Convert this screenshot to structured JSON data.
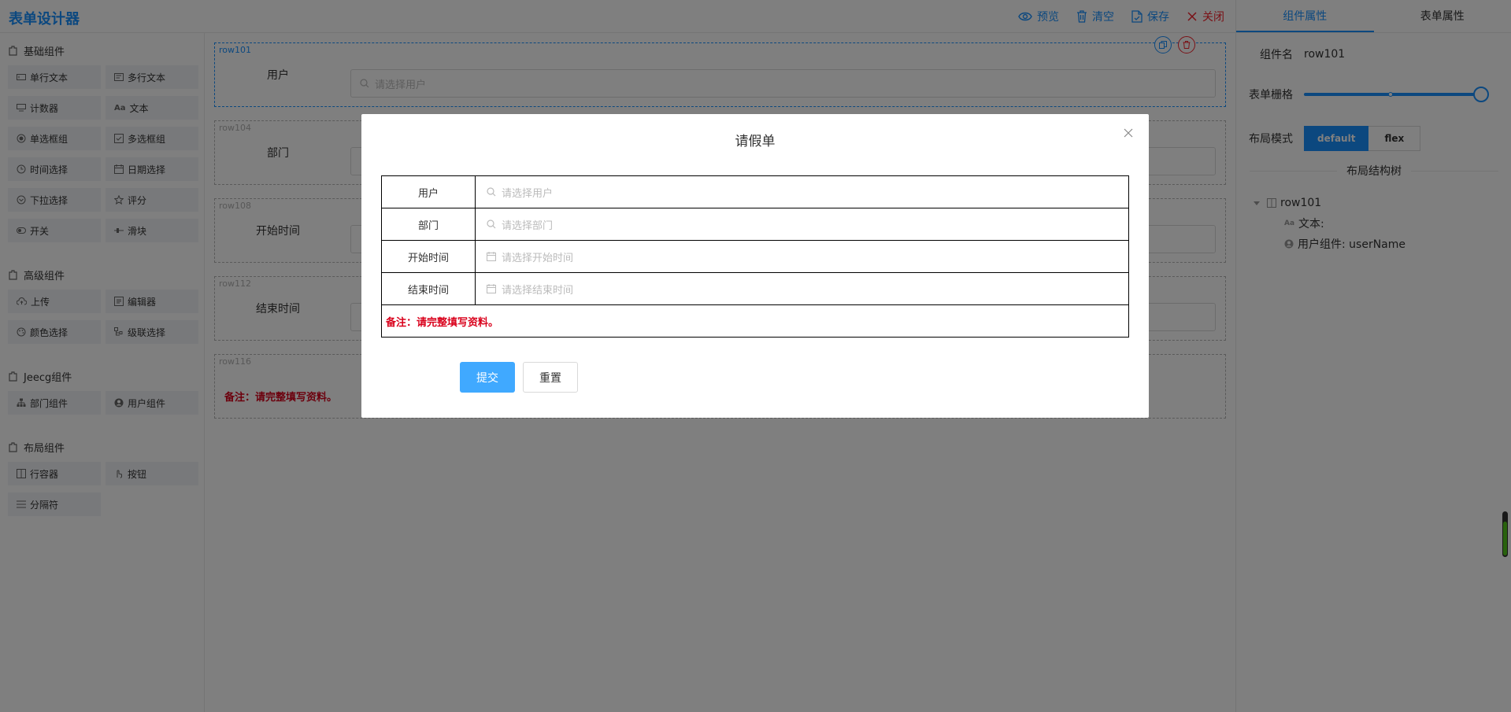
{
  "app": {
    "title": "表单设计器"
  },
  "toolbar": {
    "preview": {
      "label": "预览",
      "icon": "eye-icon"
    },
    "clear": {
      "label": "清空",
      "icon": "trash-icon"
    },
    "save": {
      "label": "保存",
      "icon": "save-icon"
    },
    "close": {
      "label": "关闭",
      "icon": "close-icon"
    }
  },
  "left_panel": {
    "groups": [
      {
        "title": "基础组件",
        "items": [
          "单行文本",
          "多行文本",
          "计数器",
          "文本",
          "单选框组",
          "多选框组",
          "时间选择",
          "日期选择",
          "下拉选择",
          "评分",
          "开关",
          "滑块"
        ]
      },
      {
        "title": "高级组件",
        "items": [
          "上传",
          "编辑器",
          "颜色选择",
          "级联选择"
        ]
      },
      {
        "title": "Jeecg组件",
        "items": [
          "部门组件",
          "用户组件"
        ]
      },
      {
        "title": "布局组件",
        "items": [
          "行容器",
          "按钮",
          "分隔符"
        ]
      }
    ]
  },
  "canvas": {
    "rows": [
      {
        "id": "row101",
        "label": "用户",
        "placeholder": "请选择用户"
      },
      {
        "id": "row104",
        "label": "部门"
      },
      {
        "id": "row108",
        "label": "开始时间"
      },
      {
        "id": "row112",
        "label": "结束时间"
      },
      {
        "id": "row116",
        "note": "备注：请完整填写资料。"
      }
    ]
  },
  "right_panel": {
    "tabs": [
      "组件属性",
      "表单属性"
    ],
    "component_name_label": "组件名",
    "component_name_value": "row101",
    "grid_label": "表单栅格",
    "grid_value": 24,
    "grid_max": 24,
    "layout_mode_label": "布局模式",
    "layout_modes": [
      "default",
      "flex"
    ],
    "layout_mode_selected": "default",
    "tree_title": "布局结构树",
    "tree": {
      "root": "row101",
      "children": [
        "文本:",
        "用户组件: userName"
      ]
    },
    "side_progress": 0.8
  },
  "modal": {
    "title": "请假单",
    "fields": [
      {
        "label": "用户",
        "placeholder": "请选择用户",
        "icon": "search-icon"
      },
      {
        "label": "部门",
        "placeholder": "请选择部门",
        "icon": "search-icon"
      },
      {
        "label": "开始时间",
        "placeholder": "请选择开始时间",
        "icon": "calendar-icon"
      },
      {
        "label": "结束时间",
        "placeholder": "请选择结束时间",
        "icon": "calendar-icon"
      }
    ],
    "note": "备注：请完整填写资料。",
    "submit_label": "提交",
    "reset_label": "重置"
  },
  "colors": {
    "primary": "#1890ff",
    "danger": "#f5222d",
    "note_red": "#d9001b",
    "submit_bg": "#40a9ff",
    "overlay": "rgba(0,0,0,0.5)"
  }
}
